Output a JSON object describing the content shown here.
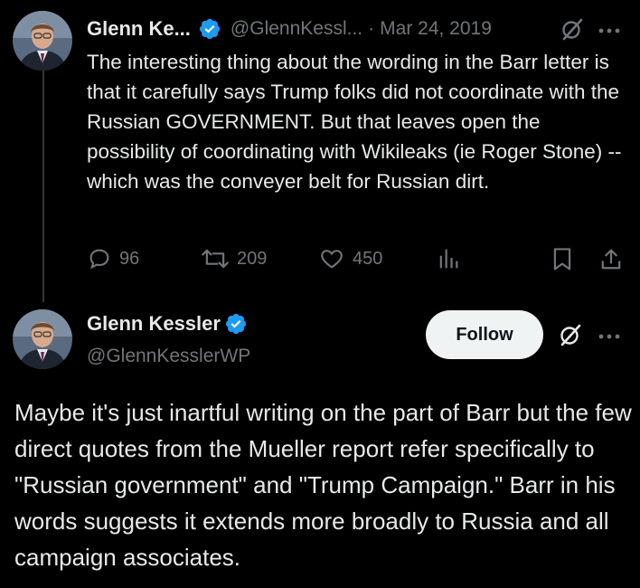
{
  "tweet1": {
    "author_name": "Glenn Ke...",
    "handle": "@GlennKessl...",
    "separator": "·",
    "date": "Mar 24, 2019",
    "text": "The interesting thing about the wording in the Barr letter is that it carefully says Trump folks did not coordinate with the Russian GOVERNMENT. But that leaves open the possibility of coordinating with Wikileaks (ie Roger Stone) -- which was the conveyer belt for Russian dirt.",
    "replies": "96",
    "retweets": "209",
    "likes": "450"
  },
  "tweet2": {
    "author_name": "Glenn Kessler",
    "handle": "@GlennKesslerWP",
    "follow_label": "Follow",
    "text": "Maybe it's just inartful writing on the part of Barr but the few direct quotes from the Mueller report refer specifically to \"Russian government\" and \"Trump Campaign.\" Barr in his words suggests it extends more broadly to Russia and all campaign associates."
  },
  "icons": {
    "verified": "verified-badge-icon",
    "grok": "grok-icon",
    "more": "more-icon",
    "reply": "reply-icon",
    "retweet": "retweet-icon",
    "like": "heart-icon",
    "views": "views-icon",
    "bookmark": "bookmark-icon",
    "share": "share-icon"
  },
  "colors": {
    "background": "#000000",
    "text": "#e7e9ea",
    "secondary": "#71767b",
    "verified": "#1d9bf0",
    "follow_bg": "#eff3f4"
  }
}
